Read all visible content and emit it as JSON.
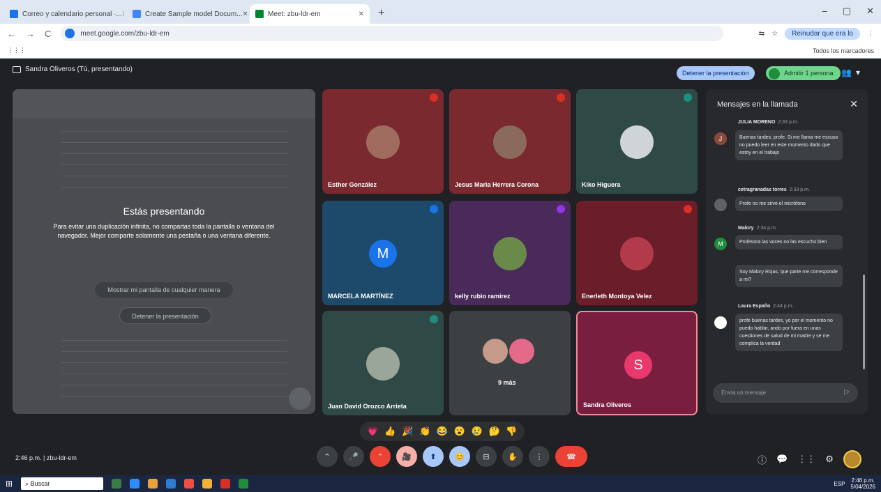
{
  "browser": {
    "tabs": [
      {
        "label": "Correo y calendario personal ·...",
        "fav_color": "#1a73e8"
      },
      {
        "label": "Create Sample model Docum...",
        "fav_color": "#4285f4"
      },
      {
        "label": "Meet: zbu-ldr-em",
        "fav_color": "#00832d"
      }
    ],
    "window_controls": [
      "–",
      "▢",
      "✕"
    ],
    "nav": [
      "←",
      "→",
      "C"
    ],
    "url": "meet.google.com/zbu-ldr-em",
    "address_right": [
      "⇆",
      "☆"
    ],
    "profile_label": "Reinudar que era lo",
    "menu_icon": "⋮",
    "bookmarks_icon": "⋮⋮⋮",
    "bookmarks_right": "Todos los marcadores"
  },
  "meet": {
    "presenter_label": "Sandra Oliveros (Tú, presentando)",
    "stop_presenting": "Detener la presentación",
    "join_label": "Admitir 1 persona",
    "top_icons": [
      "👥",
      "▾"
    ],
    "presenting": {
      "title": "Estás presentando",
      "description": "Para evitar una duplicación infinita, no compartas toda la pantalla o ventana del navegador. Mejor comparte solamente una pestaña o una ventana diferente.",
      "show_anyway": "Mostrar mi pantalla de cualquier manera",
      "stop": "Detener la presentación"
    },
    "participants": [
      {
        "name": "Esther González",
        "bg": "#7a2a2e",
        "type": "photo",
        "photo_color": "#a06c60",
        "ind_color": "#d93025"
      },
      {
        "name": "Jesus Maria Herrera Corona",
        "bg": "#7a2a2e",
        "type": "photo",
        "photo_color": "#8a6a5a",
        "ind_color": "#d93025"
      },
      {
        "name": "Kiko Higuera",
        "bg": "#2f4a46",
        "type": "photo",
        "photo_color": "#cfd4d8",
        "ind_color": "#1e8e7e"
      },
      {
        "name": "MARCELA MARTÍNEZ",
        "bg": "#1d4a6a",
        "type": "avatar",
        "letter": "M",
        "avatar_color": "#1a73e8",
        "ind_color": "#1a73e8"
      },
      {
        "name": "kelly rubio ramirez",
        "bg": "#4a2a5a",
        "type": "photo",
        "photo_color": "#6a8a4a",
        "ind_color": "#9334e6"
      },
      {
        "name": "Enerleth Montoya Velez",
        "bg": "#6a1e2a",
        "type": "photo",
        "photo_color": "#b23a4a",
        "ind_color": "#d93025"
      },
      {
        "name": "Juan David Orozco Arrieta",
        "bg": "#2f4a46",
        "type": "photo",
        "photo_color": "#9aa69a",
        "ind_color": "#1e8e7e"
      },
      {
        "name": "9 más",
        "bg": "#3c4043",
        "type": "group"
      },
      {
        "name": "Sandra Oliveros",
        "bg": "#7a1e40",
        "type": "avatar",
        "letter": "S",
        "avatar_color": "#e8386c"
      }
    ],
    "chat": {
      "title": "Mensajes en la llamada",
      "close": "✕",
      "messages": [
        {
          "author": "JULIA MORENO",
          "time": "2:33 p.m.",
          "initial": "J",
          "avatar_color": "#8a4a3a",
          "texts": [
            "Buenas tardes, profe. Si me llama me escuso no puedo leer en este momento dado que estoy en el trabajo"
          ]
        },
        {
          "author": "cetragranadas torres",
          "time": "2:33 p.m.",
          "initial": "",
          "avatar_color": "#5f6368",
          "texts": [
            "Profe no me sirve el micrófono"
          ]
        },
        {
          "author": "Malory",
          "time": "2:34 p.m.",
          "initial": "M",
          "avatar_color": "#1e8e3e",
          "texts": [
            "Profesora las voces no las escucho bien",
            "Soy Malory Rojas, que parte me corresponde a mi?"
          ]
        },
        {
          "author": "Laura Españo",
          "time": "2:44 p.m.",
          "initial": "",
          "avatar_color": "#ffffff",
          "texts": [
            "profe buenas tardes, yo por el momento no puedo hablar, ando por fuera en unas cuestiones de salud de mi madre y se me complica la verdad"
          ]
        }
      ],
      "input_placeholder": "Envía un mensaje",
      "send_icon": "▷"
    },
    "reactions": [
      "💗",
      "👍",
      "🎉",
      "👏",
      "😂",
      "😮",
      "😢",
      "🤔",
      "👎"
    ],
    "time": "2:46 p.m.",
    "meeting_code": "zbu-ldr-em",
    "controls": [
      "⌃",
      "🎤",
      "⌃",
      "🎥",
      "⬆",
      "😊",
      "⊟",
      "✋",
      "⋮",
      "☎"
    ],
    "right_controls": [
      "ⓘ",
      "💬",
      "⋮⋮",
      "⚙"
    ]
  },
  "taskbar": {
    "windows_icon": "⊞",
    "search_placeholder": "Buscar",
    "icons": [
      "#3a7d44",
      "#2d8cff",
      "#e9a23b",
      "#2d7dd2",
      "#f04e3e",
      "#f2b233",
      "#d93025",
      "#1e8e3e"
    ],
    "tray_time": "2:46 p.m.",
    "tray_date": "5/04/2026",
    "tray_lang": "ESP"
  }
}
